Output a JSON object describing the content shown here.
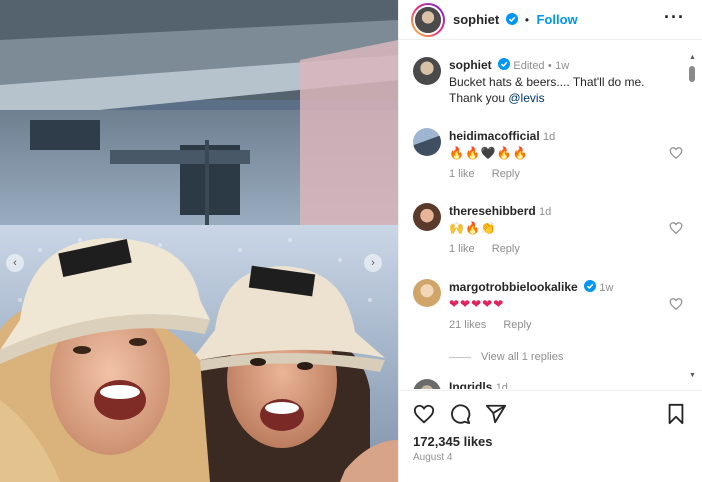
{
  "post": {
    "author": "sophiet",
    "follow_label": "Follow",
    "separator": "•"
  },
  "caption": {
    "author": "sophiet",
    "edited": "Edited",
    "time": "1w",
    "text": "Bucket hats & beers.... That'll do me.",
    "line2_prefix": "Thank you ",
    "mention": "@levis"
  },
  "comments": [
    {
      "user": "heidimacofficial",
      "time": "1d",
      "text": "🔥🔥🖤🔥🔥",
      "likes": "1 like",
      "reply": "Reply",
      "verified": false
    },
    {
      "user": "theresehibberd",
      "time": "1d",
      "text": "🙌🔥👏",
      "likes": "1 like",
      "reply": "Reply",
      "verified": false
    },
    {
      "user": "margotrobbielookalike",
      "time": "1w",
      "text": "❤❤❤❤❤",
      "likes": "21 likes",
      "reply": "Reply",
      "verified": true
    },
    {
      "user": "Ingridls",
      "time": "1d",
      "text": "",
      "likes": "",
      "reply": "",
      "verified": false
    }
  ],
  "view_replies": "View all 1 replies",
  "footer": {
    "likes": "172,345 likes",
    "date": "August 4"
  },
  "icons": {
    "verified": "verified-badge-icon",
    "more": "more-options-icon",
    "like": "heart-icon",
    "comment": "comment-icon",
    "share": "share-icon",
    "save": "bookmark-icon"
  },
  "colors": {
    "accent": "#0095f6",
    "mention": "#00376b",
    "text": "#262626",
    "muted": "#8e8e8e"
  }
}
